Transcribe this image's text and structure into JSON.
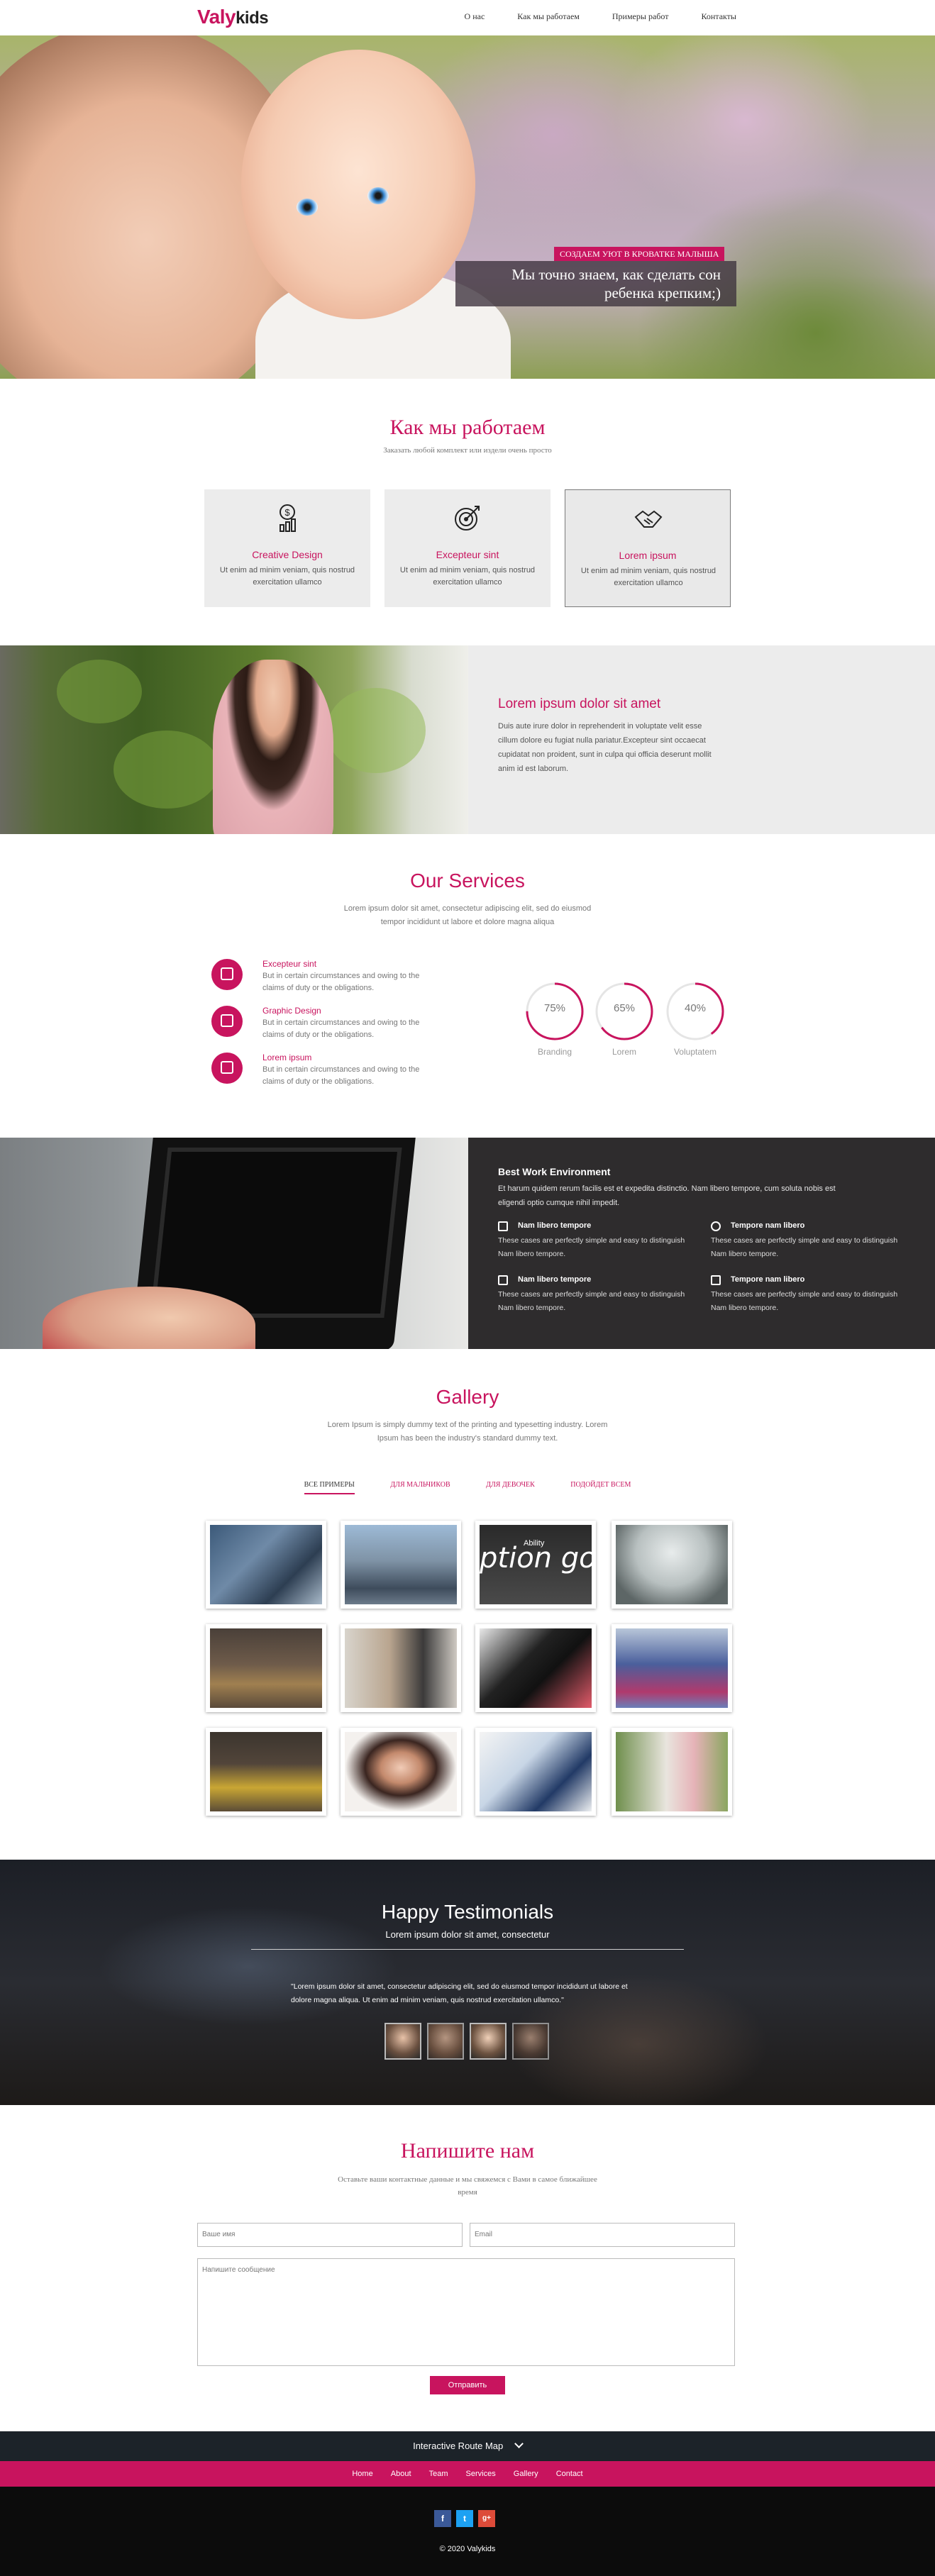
{
  "header": {
    "logo_main": "Valy",
    "logo_suffix": "kids",
    "nav": [
      "О нас",
      "Как мы работаем",
      "Примеры работ",
      "Контакты"
    ]
  },
  "hero": {
    "tag": "СОЗДАЕМ УЮТ В КРОВАТКЕ МАЛЫША",
    "line1": "Мы точно знаем, как сделать сон",
    "line2": "ребенка крепким;)"
  },
  "how": {
    "title": "Как мы работаем",
    "subtitle": "Заказать любой комплект или издели очень просто",
    "cards": [
      {
        "icon": "dollar-chart-icon",
        "title": "Creative Design",
        "text": "Ut enim ad minim veniam, quis nostrud exercitation ullamco"
      },
      {
        "icon": "target-icon",
        "title": "Excepteur sint",
        "text": "Ut enim ad minim veniam, quis nostrud exercitation ullamco"
      },
      {
        "icon": "handshake-icon",
        "title": "Lorem ipsum",
        "text": "Ut enim ad minim veniam, quis nostrud exercitation ullamco"
      }
    ]
  },
  "about": {
    "title": "Lorem ipsum dolor sit amet",
    "text": "Duis aute irure dolor in reprehenderit in voluptate velit esse cillum dolore eu fugiat nulla pariatur.Excepteur sint occaecat cupidatat non proident, sunt in culpa qui officia deserunt mollit anim id est laborum."
  },
  "services": {
    "title": "Our Services",
    "subtitle_1": "Lorem ipsum dolor sit amet, consectetur adipiscing elit, sed do eiusmod",
    "subtitle_2": "tempor incididunt ut labore et dolore magna aliqua",
    "items": [
      {
        "icon": "chart-icon",
        "title": "Excepteur sint",
        "text": "But in certain circumstances and owing to the claims of duty or the obligations."
      },
      {
        "icon": "design-icon",
        "title": "Graphic Design",
        "text": "But in certain circumstances and owing to the claims of duty or the obligations."
      },
      {
        "icon": "briefcase-icon",
        "title": "Lorem ipsum",
        "text": "But in certain circumstances and owing to the claims of duty or the obligations."
      }
    ],
    "rings": [
      {
        "value": 75,
        "text": "75%",
        "label": "Branding"
      },
      {
        "value": 65,
        "text": "65%",
        "label": "Lorem"
      },
      {
        "value": 40,
        "text": "40%",
        "label": "Voluptatem"
      }
    ]
  },
  "work": {
    "title": "Best Work Environment",
    "intro": "Et harum quidem rerum facilis est et expedita distinctio. Nam libero tempore, cum soluta nobis est eligendi optio cumque nihil impedit.",
    "features": [
      {
        "icon": "edit-icon",
        "title": "Nam libero tempore",
        "text": "These cases are perfectly simple and easy to distinguish Nam libero tempore."
      },
      {
        "icon": "clock-icon",
        "title": "Tempore nam libero",
        "text": "These cases are perfectly simple and easy to distinguish Nam libero tempore."
      },
      {
        "icon": "checklist-icon",
        "title": "Nam libero tempore",
        "text": "These cases are perfectly simple and easy to distinguish Nam libero tempore."
      },
      {
        "icon": "cutlery-icon",
        "title": "Tempore nam libero",
        "text": "These cases are perfectly simple and easy to distinguish Nam libero tempore."
      }
    ]
  },
  "gallery": {
    "title": "Gallery",
    "subtitle_1": "Lorem Ipsum is simply dummy text of the printing and typesetting industry. Lorem",
    "subtitle_2": "Ipsum has been the industry's standard dummy text.",
    "filters": [
      "ВСЕ ПРИМЕРЫ",
      "ДЛЯ МАЛЬЧИКОВ",
      "ДЛЯ ДЕВОЧЕК",
      "ПОДОЙДЕТ ВСЕМ"
    ],
    "thumb_overlay_text": "ption goe",
    "thumb_overlay_small": "Ability"
  },
  "testimonials": {
    "title": "Happy Testimonials",
    "subtitle": "Lorem ipsum dolor sit amet, consectetur",
    "quote": "\"Lorem ipsum dolor sit amet, consectetur adipiscing elit, sed do eiusmod tempor incididunt ut labore et dolore magna aliqua. Ut enim ad minim veniam, quis nostrud exercitation ullamco.\""
  },
  "contact": {
    "title": "Напишите нам",
    "subtitle_1": "Оставьте ваши контактные данные и мы свяжемся с Вами в самое ближайшее",
    "subtitle_2": "время",
    "name_placeholder": "Ваше имя",
    "email_placeholder": "Email",
    "message_placeholder": "Напишите сообщение",
    "send_label": "Отправить"
  },
  "footer": {
    "map_label": "Interactive Route Map",
    "nav": [
      "Home",
      "About",
      "Team",
      "Services",
      "Gallery",
      "Contact"
    ],
    "social": [
      "f",
      "t",
      "g+"
    ],
    "copyright": "© 2020 Valykids"
  },
  "colors": {
    "accent": "#c8145e",
    "dark": "#2e2c2d",
    "footer": "#0c0c0c"
  }
}
